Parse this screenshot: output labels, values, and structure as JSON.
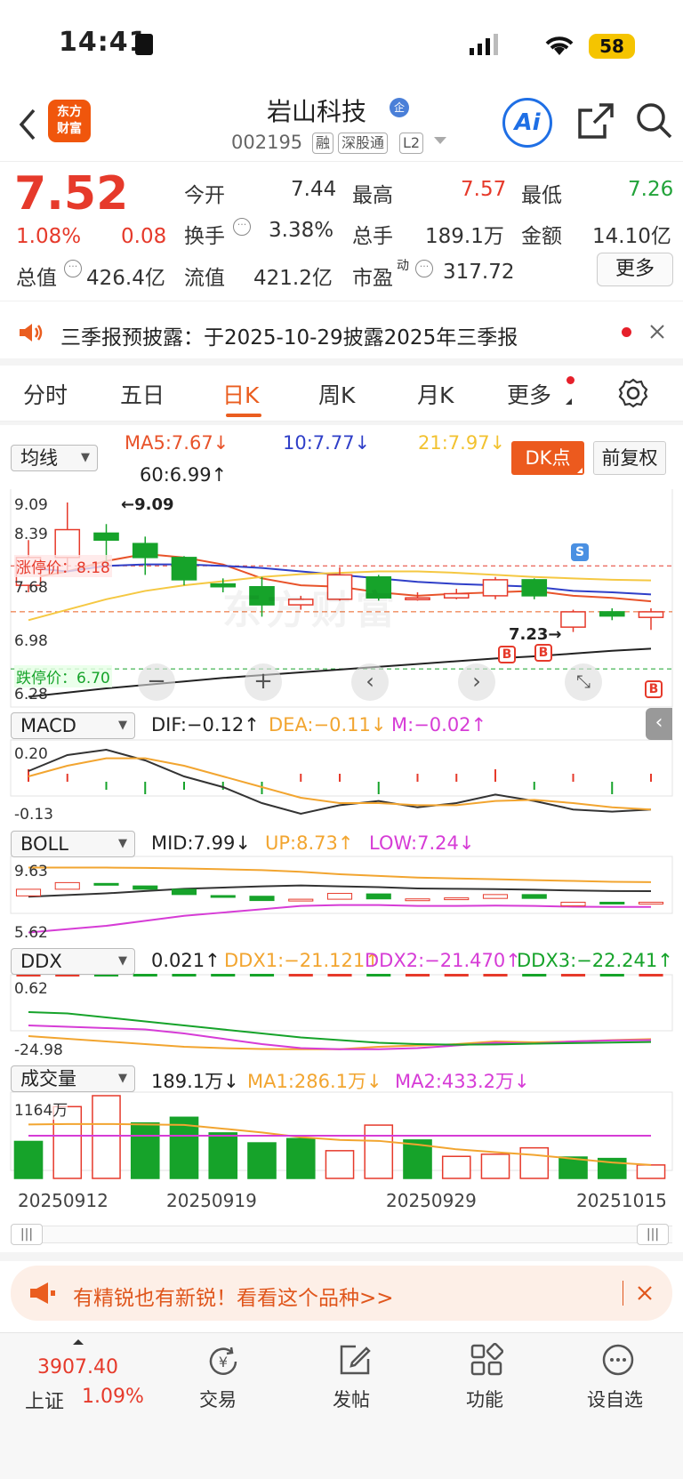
{
  "status": {
    "time": "14:41",
    "battery": "58"
  },
  "header": {
    "logo_line1": "东方",
    "logo_line2": "财富",
    "title": "岩山科技",
    "ent_badge": "企",
    "code": "002195",
    "tags": [
      "融",
      "深股通",
      "L2"
    ]
  },
  "quote": {
    "price": "7.52",
    "change_pct": "1.08%",
    "change": "0.08",
    "open_label": "今开",
    "open": "7.44",
    "high_label": "最高",
    "high": "7.57",
    "low_label": "最低",
    "low": "7.26",
    "turnover_label": "换手",
    "turnover": "3.38%",
    "volume_label": "总手",
    "volume": "189.1万",
    "amount_label": "金额",
    "amount": "14.10亿",
    "mktcap_label": "总值",
    "mktcap": "426.4亿",
    "float_label": "流值",
    "float": "421.2亿",
    "pe_label": "市盈",
    "pe_sup": "动",
    "pe": "317.72",
    "more": "更多"
  },
  "notice": {
    "text": "三季报预披露：于2025-10-29披露2025年三季报"
  },
  "tabs": [
    "分时",
    "五日",
    "日K",
    "周K",
    "月K",
    "更多"
  ],
  "active_tab": 2,
  "kline": {
    "selector": "均线",
    "ma5": "MA5:7.67↓",
    "ma10": "10:7.77↓",
    "ma21": "21:7.97↓",
    "ma60": "60:6.99↑",
    "dk_button": "DK点",
    "fq_button": "前复权",
    "y_labels": [
      "9.09",
      "8.39",
      "7.68",
      "6.98",
      "6.28"
    ],
    "max_mark": "←9.09",
    "min_mark": "7.23→",
    "limit_up": "涨停价：8.18",
    "limit_down": "跌停价：6.70",
    "s_marker": "S",
    "b_marker": "B",
    "watermark": "东方财富"
  },
  "macd": {
    "selector": "MACD",
    "dif": "DIF:−0.12↑",
    "dea": "DEA:−0.11↓",
    "m": "M:−0.02↑",
    "y_labels": [
      "0.20",
      "-0.13"
    ]
  },
  "boll": {
    "selector": "BOLL",
    "mid": "MID:7.99↓",
    "up": "UP:8.73↑",
    "low": "LOW:7.24↓",
    "y_labels": [
      "9.63",
      "5.62"
    ]
  },
  "ddx": {
    "selector": "DDX",
    "ddx": "0.021↑",
    "ddx1": "DDX1:−21.121↑",
    "ddx2": "DDX2:−21.470↑",
    "ddx3": "DDX3:−22.241↑",
    "y_labels": [
      "0.62",
      "-24.98"
    ]
  },
  "vol": {
    "selector": "成交量",
    "vol": "189.1万↓",
    "ma1": "MA1:286.1万↓",
    "ma2": "MA2:433.2万↓",
    "y_label": "1164万"
  },
  "dates": [
    "20250912",
    "20250919",
    "20250929",
    "20251015"
  ],
  "chart_data": {
    "type": "candlestick",
    "candles": [
      {
        "o": 7.9,
        "c": 8.3,
        "h": 8.55,
        "l": 7.8,
        "dir": "up"
      },
      {
        "o": 8.3,
        "c": 8.7,
        "h": 9.09,
        "l": 8.1,
        "dir": "up"
      },
      {
        "o": 8.65,
        "c": 8.55,
        "h": 8.78,
        "l": 8.2,
        "dir": "down"
      },
      {
        "o": 8.5,
        "c": 8.3,
        "h": 8.6,
        "l": 8.05,
        "dir": "down"
      },
      {
        "o": 8.3,
        "c": 7.98,
        "h": 8.32,
        "l": 7.9,
        "dir": "down"
      },
      {
        "o": 7.92,
        "c": 7.88,
        "h": 8.0,
        "l": 7.8,
        "dir": "down"
      },
      {
        "o": 7.88,
        "c": 7.62,
        "h": 8.02,
        "l": 7.45,
        "dir": "down"
      },
      {
        "o": 7.62,
        "c": 7.7,
        "h": 7.75,
        "l": 7.55,
        "dir": "up"
      },
      {
        "o": 7.7,
        "c": 8.05,
        "h": 8.16,
        "l": 7.68,
        "dir": "up"
      },
      {
        "o": 8.02,
        "c": 7.72,
        "h": 8.05,
        "l": 7.68,
        "dir": "down"
      },
      {
        "o": 7.7,
        "c": 7.72,
        "h": 7.8,
        "l": 7.68,
        "dir": "up"
      },
      {
        "o": 7.72,
        "c": 7.78,
        "h": 7.85,
        "l": 7.7,
        "dir": "up"
      },
      {
        "o": 7.75,
        "c": 7.98,
        "h": 8.02,
        "l": 7.7,
        "dir": "up"
      },
      {
        "o": 7.98,
        "c": 7.75,
        "h": 8.0,
        "l": 7.7,
        "dir": "down"
      },
      {
        "o": 7.3,
        "c": 7.52,
        "h": 7.55,
        "l": 7.23,
        "dir": "up"
      },
      {
        "o": 7.52,
        "c": 7.46,
        "h": 7.57,
        "l": 7.4,
        "dir": "down"
      },
      {
        "o": 7.44,
        "c": 7.52,
        "h": 7.57,
        "l": 7.26,
        "dir": "up"
      }
    ],
    "volume": [
      520,
      1010,
      1164,
      780,
      860,
      640,
      500,
      560,
      390,
      750,
      540,
      310,
      340,
      430,
      300,
      280,
      189.1
    ],
    "volume_dir": [
      "down",
      "up",
      "up",
      "down",
      "down",
      "down",
      "down",
      "down",
      "up",
      "up",
      "down",
      "up",
      "up",
      "up",
      "down",
      "down",
      "up"
    ],
    "price_ylim": [
      6.28,
      9.09
    ],
    "ma_lines": {
      "MA5": [
        8.0,
        8.1,
        8.25,
        8.35,
        8.3,
        8.2,
        8.0,
        7.9,
        7.88,
        7.8,
        7.75,
        7.78,
        7.8,
        7.82,
        7.75,
        7.72,
        7.67
      ],
      "MA10": [
        8.15,
        8.1,
        8.18,
        8.2,
        8.2,
        8.18,
        8.15,
        8.1,
        8.05,
        8.0,
        7.95,
        7.92,
        7.9,
        7.88,
        7.82,
        7.8,
        7.77
      ],
      "MA21": [
        7.4,
        7.55,
        7.7,
        7.82,
        7.9,
        7.96,
        8.02,
        8.06,
        8.08,
        8.1,
        8.1,
        8.08,
        8.05,
        8.02,
        8.0,
        7.98,
        7.97
      ],
      "MA60": [
        6.3,
        6.36,
        6.42,
        6.47,
        6.52,
        6.57,
        6.61,
        6.65,
        6.69,
        6.73,
        6.77,
        6.81,
        6.85,
        6.88,
        6.92,
        6.96,
        6.99
      ]
    }
  },
  "promo": {
    "text": "有精锐也有新锐！看看这个品种>>"
  },
  "bottom": {
    "index_value": "3907.40",
    "index_name": "上证",
    "index_pct": "1.09%",
    "trade": "交易",
    "post": "发帖",
    "func": "功能",
    "watch": "设自选"
  },
  "colors": {
    "up": "#e63a2b",
    "down": "#16a32a",
    "accent": "#ea5d1f",
    "ma5": "#e8532a",
    "ma10": "#2f3fc8",
    "ma21": "#f5c842",
    "ma60": "#222222"
  }
}
